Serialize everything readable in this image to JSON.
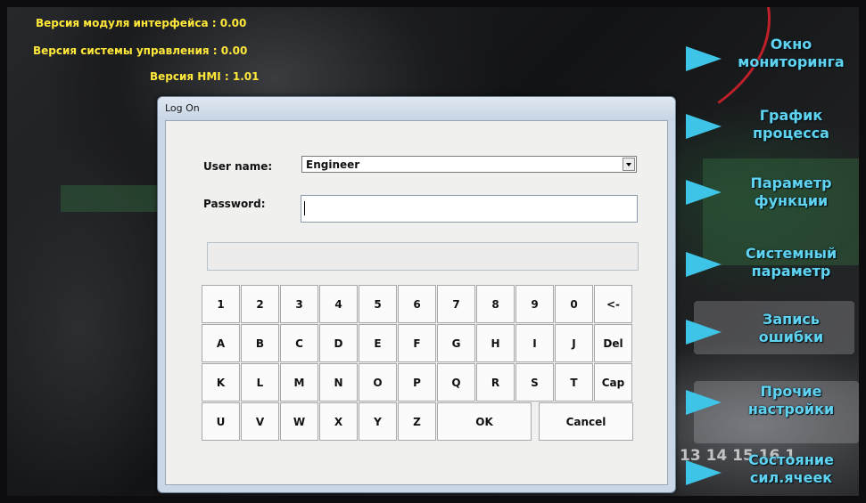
{
  "version_info": {
    "interface_module": "Версия модуля интерфейса : 0.00",
    "control_system": "Версия системы управления : 0.00",
    "hmi": "Версия HMI : 1.01"
  },
  "menu": [
    {
      "label": "Окно\nмониторинга"
    },
    {
      "label": "График\nпроцесса"
    },
    {
      "label": "Параметр\nфункции"
    },
    {
      "label": "Системный\nпараметр"
    },
    {
      "label": "Запись\nошибки"
    },
    {
      "label": "Прочие\nнастройки"
    },
    {
      "label": "Состояние\nсил.ячеек"
    }
  ],
  "dialog": {
    "title": "Log On",
    "username_label": "User name:",
    "username_value": "Engineer",
    "password_label": "Password:",
    "password_value": ""
  },
  "keyboard": {
    "row1": [
      "1",
      "2",
      "3",
      "4",
      "5",
      "6",
      "7",
      "8",
      "9",
      "0",
      "<-"
    ],
    "row2": [
      "A",
      "B",
      "C",
      "D",
      "E",
      "F",
      "G",
      "H",
      "I",
      "J",
      "Del"
    ],
    "row3": [
      "K",
      "L",
      "M",
      "N",
      "O",
      "P",
      "Q",
      "R",
      "S",
      "T",
      "Cap"
    ],
    "row4": [
      "U",
      "V",
      "W",
      "X",
      "Y",
      "Z"
    ],
    "ok": "OK",
    "cancel": "Cancel"
  },
  "colors": {
    "version_text": "#ffe83a",
    "menu_text": "#5fd3f0",
    "menu_arrow": "#3ec4e6"
  },
  "background_digits": "13 14 15 16 1"
}
